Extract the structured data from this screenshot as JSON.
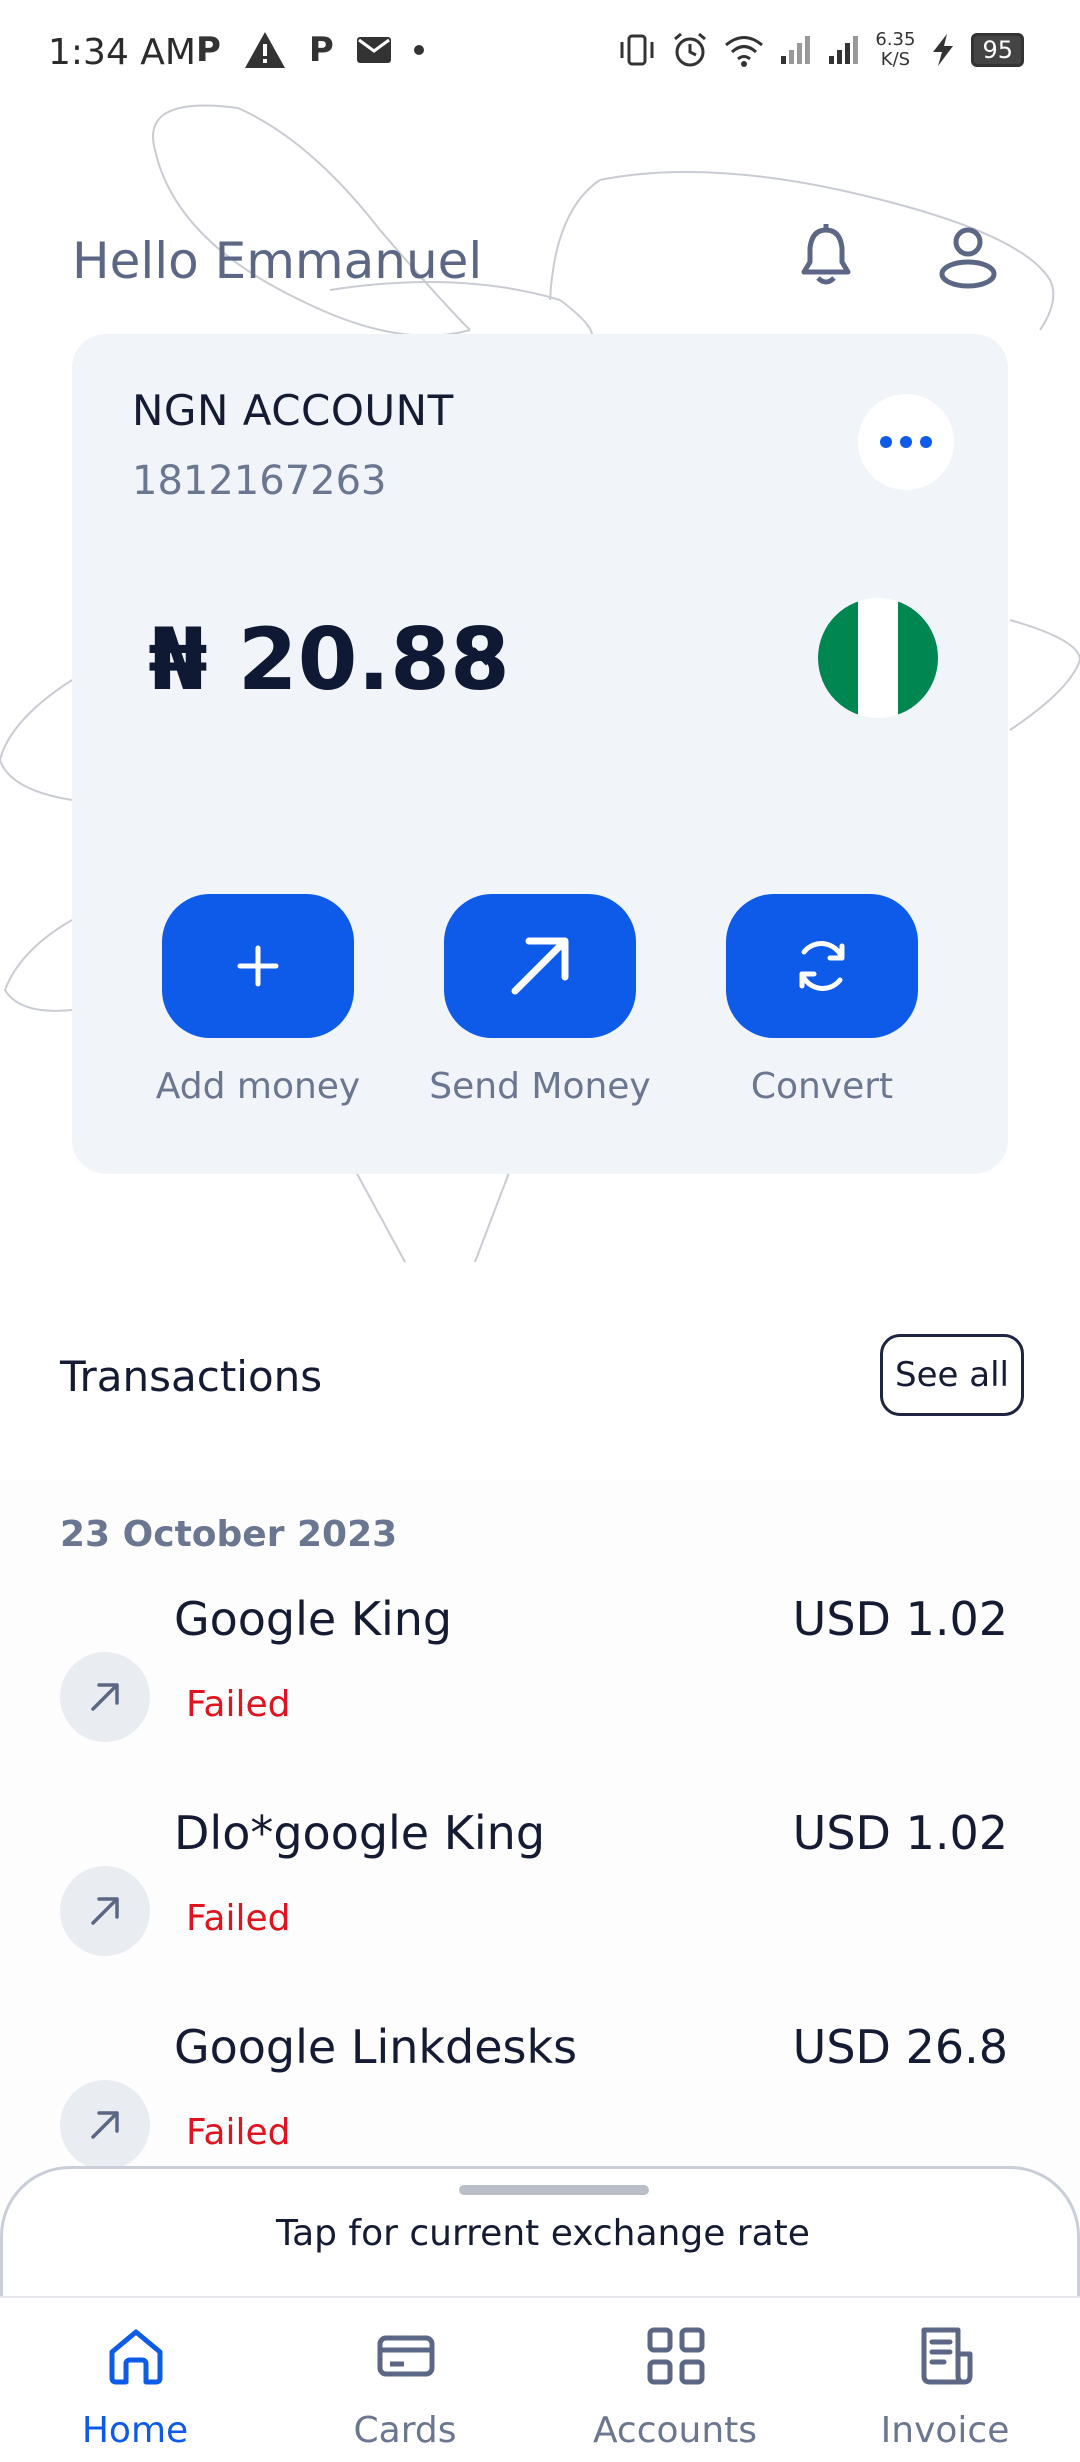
{
  "status_bar": {
    "time": "1:34 AM",
    "net_speed_value": "6.35",
    "net_speed_unit": "K/S",
    "battery": "95"
  },
  "header": {
    "greeting": "Hello Emmanuel"
  },
  "account_card": {
    "title": "NGN ACCOUNT",
    "number": "1812167263",
    "balance": "₦ 20.88",
    "flag_colors": [
      "#008751",
      "#ffffff",
      "#008751"
    ],
    "actions": [
      {
        "label": "Add money",
        "icon": "plus-icon"
      },
      {
        "label": "Send Money",
        "icon": "arrow-up-right-icon"
      },
      {
        "label": "Convert",
        "icon": "refresh-icon"
      }
    ]
  },
  "transactions": {
    "title": "Transactions",
    "see_all": "See all",
    "date": "23 October 2023",
    "items": [
      {
        "name": "Google King",
        "amount": "USD 1.02",
        "status": "Failed"
      },
      {
        "name": "Dlo*google King",
        "amount": "USD 1.02",
        "status": "Failed"
      },
      {
        "name": "Google Linkdesks",
        "amount": "USD 26.8",
        "status": "Failed"
      }
    ]
  },
  "exchange_sheet": {
    "text": "Tap for current exchange rate"
  },
  "nav": {
    "items": [
      {
        "label": "Home",
        "icon": "home-icon",
        "active": true
      },
      {
        "label": "Cards",
        "icon": "card-icon",
        "active": false
      },
      {
        "label": "Accounts",
        "icon": "grid-icon",
        "active": false
      },
      {
        "label": "Invoice",
        "icon": "invoice-icon",
        "active": false
      }
    ]
  },
  "colors": {
    "accent": "#0d5be8",
    "failed": "#e0141e",
    "card_bg": "#f1f4f8"
  }
}
